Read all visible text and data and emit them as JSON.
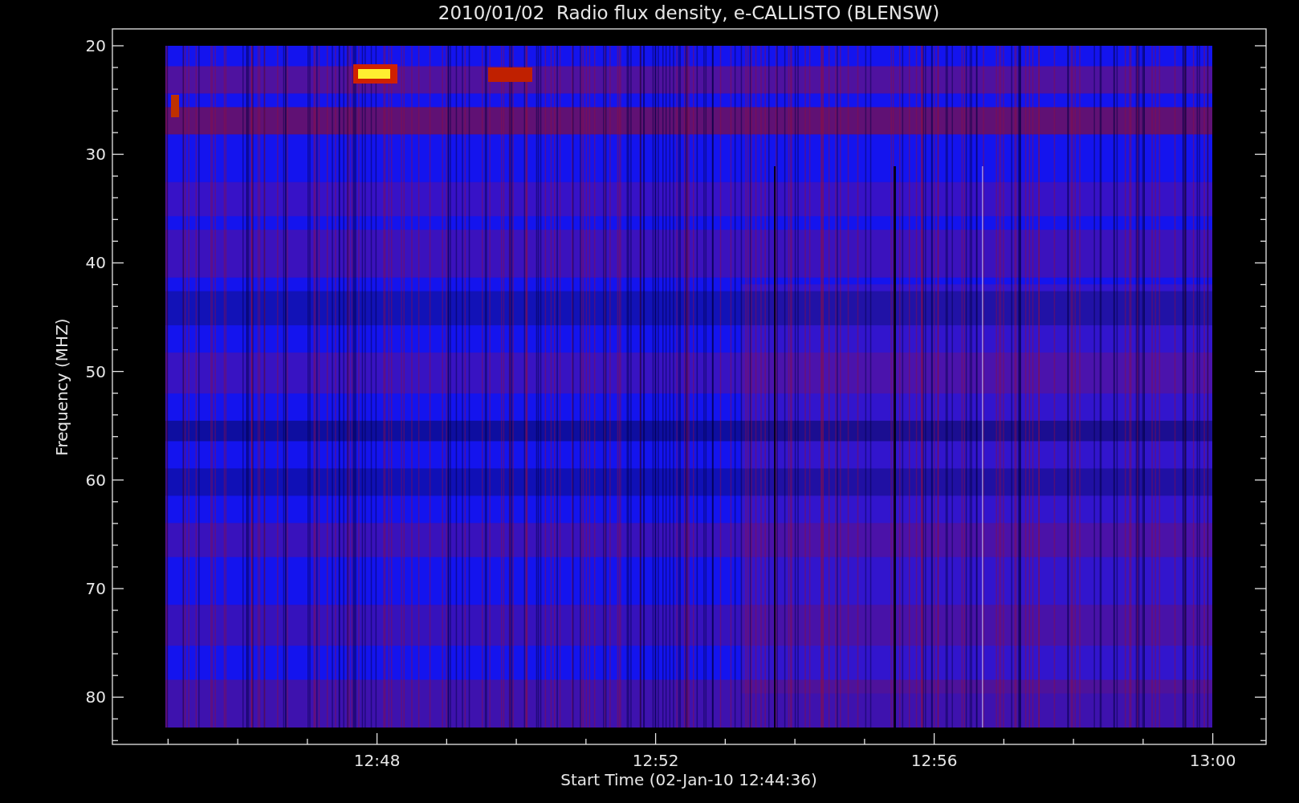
{
  "title": "2010/01/02  Radio flux density, e-CALLISTO (BLENSW)",
  "y_axis": {
    "label": "Frequency (MHZ)",
    "ticks": [
      "20",
      "30",
      "40",
      "50",
      "60",
      "70",
      "80"
    ]
  },
  "x_axis": {
    "label": "Start Time (02-Jan-10 12:44:36)",
    "ticks": [
      "12:48",
      "12:52",
      "12:56",
      "13:00"
    ]
  }
}
